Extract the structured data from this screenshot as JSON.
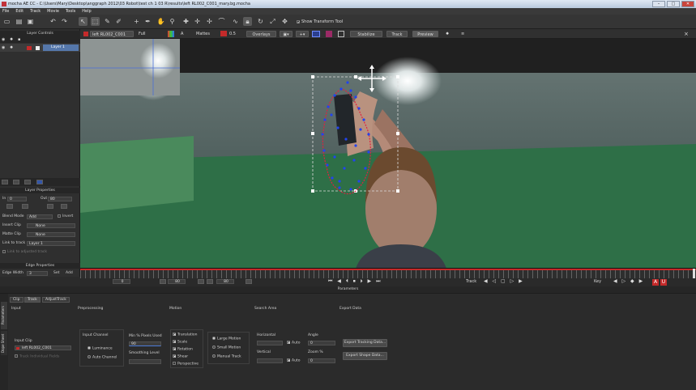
{
  "window": {
    "title": "mocha AE CC - C:\\Users\\Mary\\Desktop\\anggraph 2012\\03 Robot\\test ch 1 03 R\\results\\left RL002_C001_mary.bg.mocha"
  },
  "menu": [
    "File",
    "Edit",
    "Track",
    "Movie",
    "Tools",
    "Help"
  ],
  "toolbar": {
    "show_transform_tool": "Show Transform Tool"
  },
  "toolbar2": {
    "clip": "left RL002_C001",
    "view_mode": "Full",
    "alpha": "A",
    "mattes": "Mattes",
    "opacity": "0.5",
    "overlays": "Overlays",
    "stabilize": "Stabilize",
    "track": "Track",
    "preview": "Preview"
  },
  "layer_controls": {
    "header": "Layer Controls",
    "layer_name": "Layer 1"
  },
  "layer_properties": {
    "header": "Layer Properties",
    "in_label": "In",
    "in_value": "0",
    "out_label": "Out",
    "out_value": "80",
    "blend_mode_label": "Blend Mode",
    "blend_mode": "Add",
    "invert_label": "Invert",
    "insert_clip_label": "Insert Clip",
    "insert_clip": "None",
    "matte_clip_label": "Matte Clip",
    "matte_clip": "None",
    "link_to_track_label": "Link to track",
    "link_to_track": "Layer 1",
    "link_adjusted_label": "Link to adjusted track"
  },
  "edge_properties": {
    "header": "Edge Properties",
    "edge_width_label": "Edge Width",
    "edge_width": "3",
    "set_label": "Set",
    "add_label": "Add"
  },
  "transport": {
    "start": "0",
    "current": "80",
    "end": "80",
    "track_label": "Track",
    "key_label": "Key",
    "params": "Parameters"
  },
  "params": {
    "tabs": [
      "Clip",
      "Track",
      "AdjustTrack"
    ],
    "side_tabs": [
      "Parameters",
      "Dope Sheet"
    ],
    "input": {
      "header": "Input",
      "clip_label": "Input Clip",
      "clip_value": "left RL002_C001",
      "track_individual": "Track Individual Fields"
    },
    "preprocessing": {
      "header": "Preprocessing",
      "channel_label": "Input Channel",
      "luminance": "Luminance",
      "auto_channel": "Auto Channel",
      "min_pixels_label": "Min % Pixels Used",
      "min_pixels": "90",
      "smoothing_label": "Smoothing Level",
      "smoothing": "0"
    },
    "motion": {
      "header": "Motion",
      "translation": "Translation",
      "scale": "Scale",
      "rotation": "Rotation",
      "shear": "Shear",
      "perspective": "Perspective",
      "large_motion": "Large Motion",
      "small_motion": "Small Motion",
      "manual_track": "Manual Track"
    },
    "search_area": {
      "header": "Search Area",
      "horizontal": "Horizontal",
      "vertical": "Vertical",
      "auto_h": "Auto",
      "auto_v": "Auto",
      "angle_label": "Angle",
      "angle": "0",
      "zoom_label": "Zoom %",
      "zoom": "0"
    },
    "export": {
      "header": "Export Data",
      "tracking": "Export Tracking Data...",
      "shape": "Export Shape Data..."
    }
  },
  "colors": {
    "accent": "#c42a2a",
    "point": "#2244ee",
    "spline": "#e02040"
  }
}
